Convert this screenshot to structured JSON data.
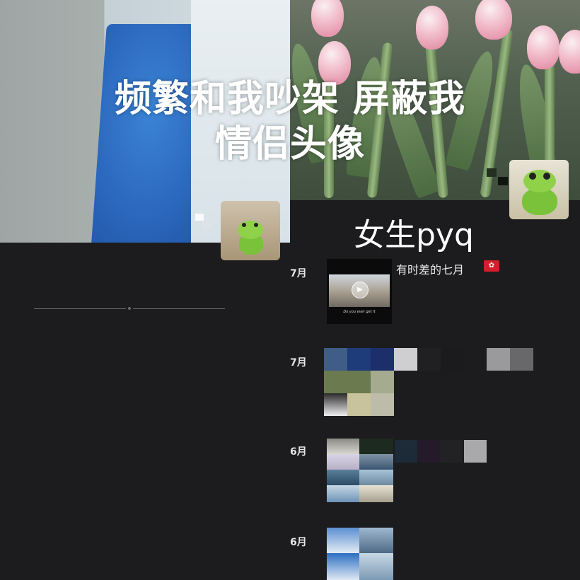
{
  "headline": {
    "line1": "频繁和我吵架 屏蔽我",
    "line2": "情侣头像"
  },
  "subtitle": "女生pyq",
  "feed": {
    "posts": [
      {
        "month": "7月",
        "text": "有时差的七月",
        "flag_icon": "hong-kong-flag-icon",
        "video_caption": "Do you ever get it"
      },
      {
        "month": "7月"
      },
      {
        "month": "6月"
      },
      {
        "month": "6月"
      }
    ]
  },
  "colors": {
    "background": "#1c1c1e",
    "text": "#ffffff"
  }
}
